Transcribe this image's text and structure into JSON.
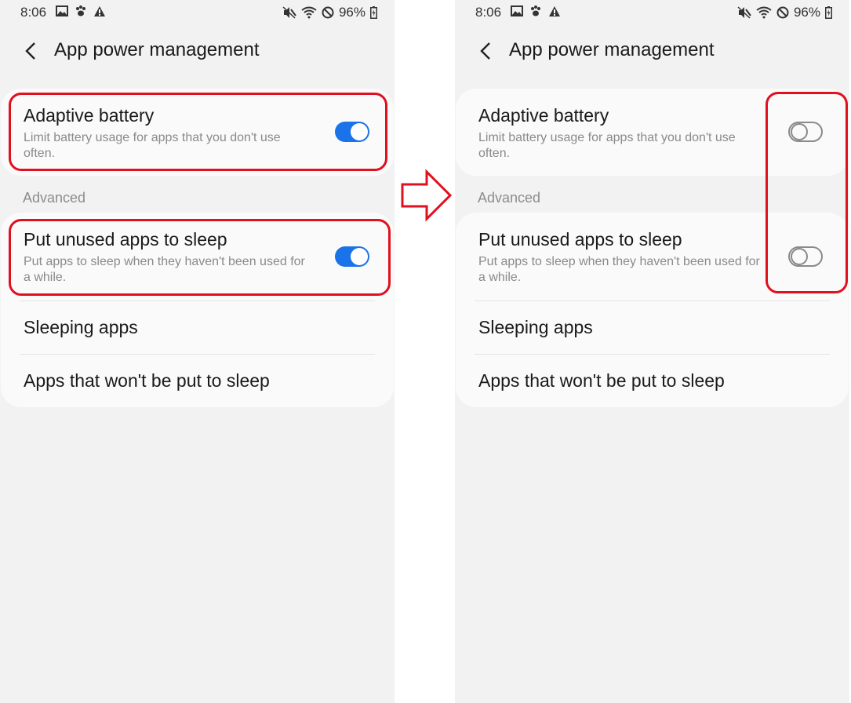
{
  "status": {
    "time": "8:06",
    "battery": "96%"
  },
  "header": {
    "title": "App power management"
  },
  "adaptive": {
    "title": "Adaptive battery",
    "subtitle": "Limit battery usage for apps that you don't use often."
  },
  "advanced_label": "Advanced",
  "sleep": {
    "title": "Put unused apps to sleep",
    "subtitle": "Put apps to sleep when they haven't been used for a while."
  },
  "sleeping_apps": "Sleeping apps",
  "never_sleep": "Apps that won't be put to sleep",
  "panels": {
    "left": {
      "adaptive_toggle": "on",
      "sleep_toggle": "on"
    },
    "right": {
      "adaptive_toggle": "off",
      "sleep_toggle": "off"
    }
  },
  "colors": {
    "accent": "#1a73e8",
    "highlight": "#e0101e",
    "background": "#f2f2f2"
  },
  "icons": [
    "gallery-icon",
    "paw-icon",
    "warning-icon",
    "mute-icon",
    "wifi-icon",
    "blocked-icon",
    "battery-icon",
    "back-icon",
    "right-arrow-icon"
  ]
}
